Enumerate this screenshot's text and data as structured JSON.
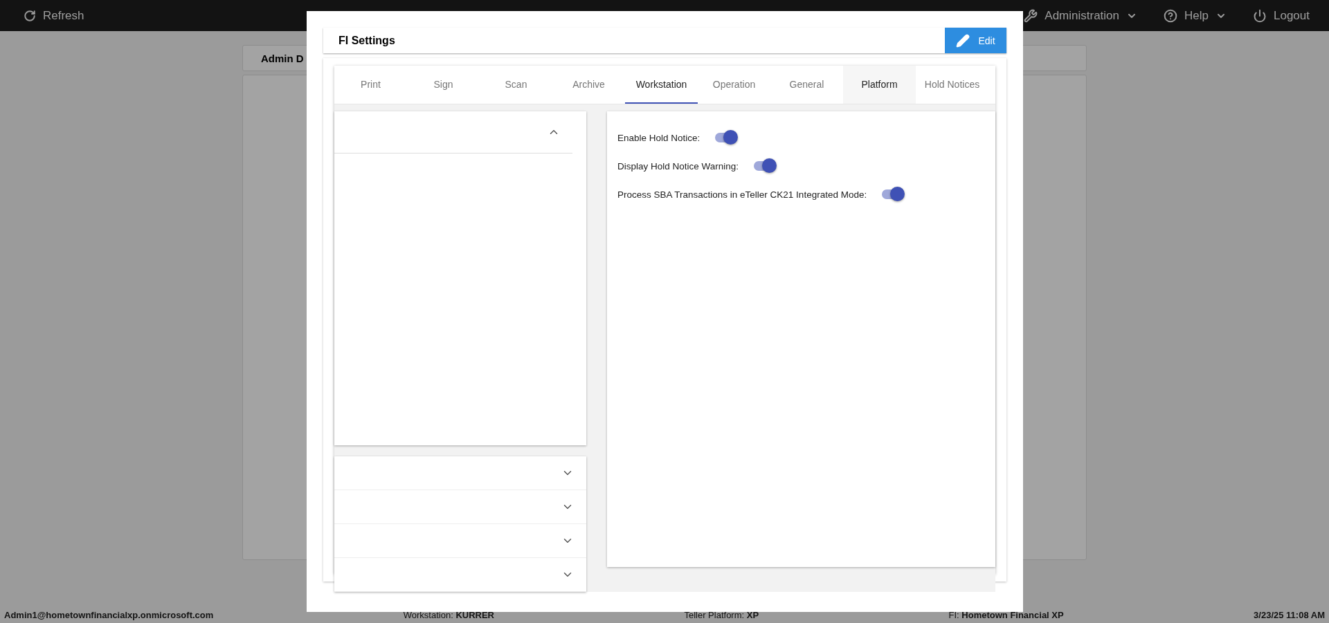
{
  "top_bar": {
    "refresh": "Refresh",
    "menus": [
      {
        "kind": "admin",
        "label": "Administration",
        "dropdown": true
      },
      {
        "kind": "help",
        "label": "Help",
        "dropdown": true
      },
      {
        "kind": "logout",
        "label": "Logout",
        "dropdown": false
      }
    ]
  },
  "background_panel": {
    "title": "Admin D"
  },
  "status_bar": [
    {
      "value": "Admin1@hometownfinancialxp.onmicrosoft.com"
    },
    {
      "label": "Workstation:",
      "value": "KURRER"
    },
    {
      "label": "Teller Platform:",
      "value": "XP"
    },
    {
      "label": "FI:",
      "value": "Hometown Financial XP"
    },
    {
      "value": "3/23/25 11:08 AM"
    }
  ],
  "dialog": {
    "title": "FI Settings",
    "edit_button": "Edit",
    "tabs": [
      {
        "label": "Print",
        "selected": false,
        "highlighted": false
      },
      {
        "label": "Sign",
        "selected": false,
        "highlighted": false
      },
      {
        "label": "Scan",
        "selected": false,
        "highlighted": false
      },
      {
        "label": "Archive",
        "selected": false,
        "highlighted": false
      },
      {
        "label": "Workstation",
        "selected": true,
        "highlighted": false
      },
      {
        "label": "Operation",
        "selected": false,
        "highlighted": false
      },
      {
        "label": "General",
        "selected": false,
        "highlighted": false
      },
      {
        "label": "Platform",
        "selected": false,
        "highlighted": true
      },
      {
        "label": "Hold Notices",
        "selected": false,
        "highlighted": false
      }
    ],
    "sections": [
      {
        "expanded": true
      },
      {
        "expanded": false
      },
      {
        "expanded": false
      },
      {
        "expanded": false
      },
      {
        "expanded": false
      }
    ],
    "settings": [
      {
        "label": "Enable Hold Notice:",
        "on": true
      },
      {
        "label": "Display Hold Notice Warning:",
        "on": true
      },
      {
        "label": "Process SBA Transactions in eTeller CK21 Integrated Mode:",
        "on": true
      }
    ]
  }
}
